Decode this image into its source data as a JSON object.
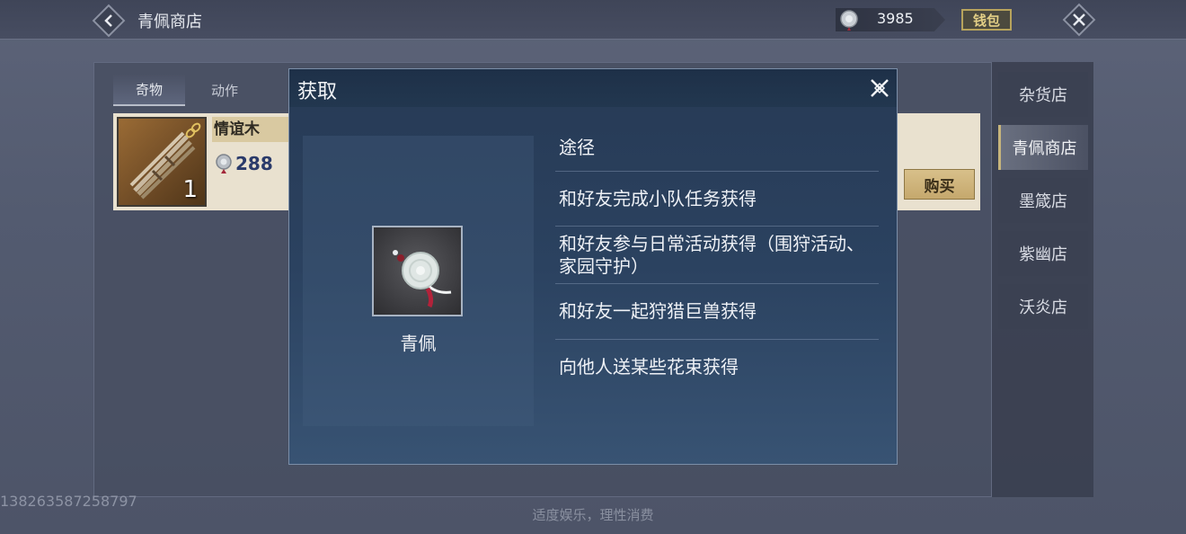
{
  "header": {
    "shop_title": "青佩商店",
    "currency_value": "3985",
    "wallet_label": "钱包"
  },
  "tabs": [
    {
      "label": "奇物",
      "active": true
    },
    {
      "label": "动作",
      "active": false
    }
  ],
  "item": {
    "name": "情谊木",
    "price": "288",
    "quantity": "1"
  },
  "buy_label": "购买",
  "side_nav": [
    {
      "label": "杂货店",
      "active": false
    },
    {
      "label": "青佩商店",
      "active": true
    },
    {
      "label": "墨箴店",
      "active": false
    },
    {
      "label": "紫幽店",
      "active": false
    },
    {
      "label": "沃炎店",
      "active": false
    }
  ],
  "modal": {
    "title": "获取",
    "preview_name": "青佩",
    "ways_title": "途径",
    "ways": [
      "和好友完成小队任务获得",
      "和好友参与日常活动获得（围狩活动、家园守护）",
      "和好友一起狩猎巨兽获得",
      "向他人送某些花束获得"
    ]
  },
  "uid": "138263587258797",
  "footer_note": "适度娱乐，理性消费",
  "colors": {
    "accent_gold": "#c7b57c",
    "modal_bg": "#2b4260",
    "card_bg": "#e9e1cf"
  }
}
